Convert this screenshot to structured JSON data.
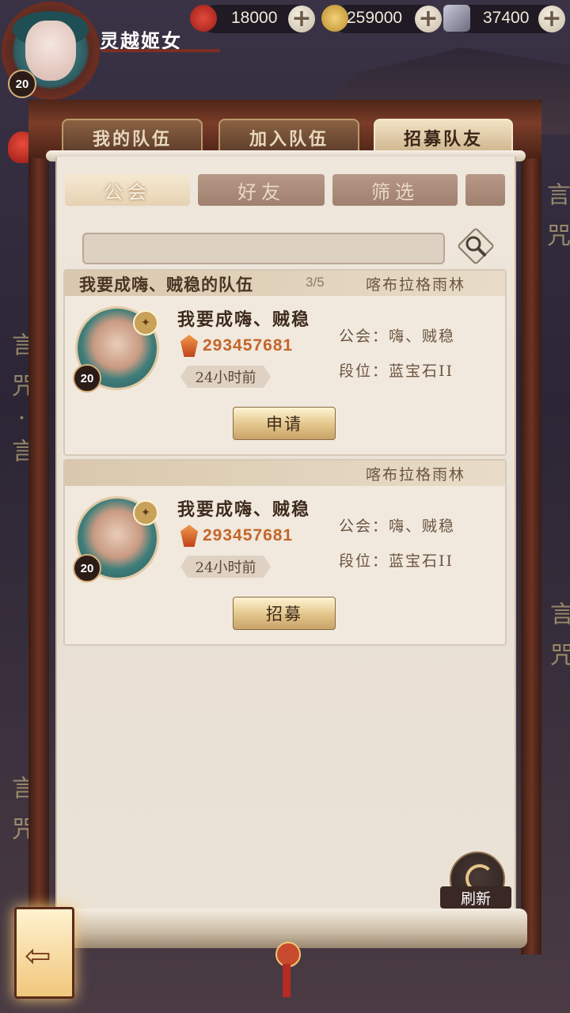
{
  "player": {
    "name": "灵越姬女",
    "level": "20"
  },
  "resources": [
    {
      "name": "stamina",
      "icon": "red-swirl-icon",
      "value": "18000"
    },
    {
      "name": "coins",
      "icon": "gold-coin-icon",
      "value": "259000"
    },
    {
      "name": "jade",
      "icon": "crystal-icon",
      "value": "37400"
    }
  ],
  "main_tabs": [
    {
      "label": "我的队伍",
      "active": false
    },
    {
      "label": "加入队伍",
      "active": false
    },
    {
      "label": "招募队友",
      "active": true
    }
  ],
  "sub_tabs": [
    {
      "label": "公会",
      "active": true
    },
    {
      "label": "好友",
      "active": false
    },
    {
      "label": "筛选",
      "active": false
    }
  ],
  "search": {
    "placeholder": ""
  },
  "cards": [
    {
      "team_name": "我要成嗨、贼稳的队伍",
      "count": "3/5",
      "location": "喀布拉格雨林",
      "player_name": "我要成嗨、贼稳",
      "level": "20",
      "power": "293457681",
      "time": "24小时前",
      "guild": "公会：嗨、贼稳",
      "rank": "段位：蓝宝石II",
      "action": "申请"
    },
    {
      "team_name": "",
      "count": "",
      "location": "喀布拉格雨林",
      "player_name": "我要成嗨、贼稳",
      "level": "20",
      "power": "293457681",
      "time": "24小时前",
      "guild": "公会：嗨、贼稳",
      "rank": "段位：蓝宝石II",
      "action": "招募"
    }
  ],
  "refresh_label": "刷新",
  "colors": {
    "accent": "#c4652a",
    "frame": "#6d3323",
    "paper": "#efe7dc"
  }
}
